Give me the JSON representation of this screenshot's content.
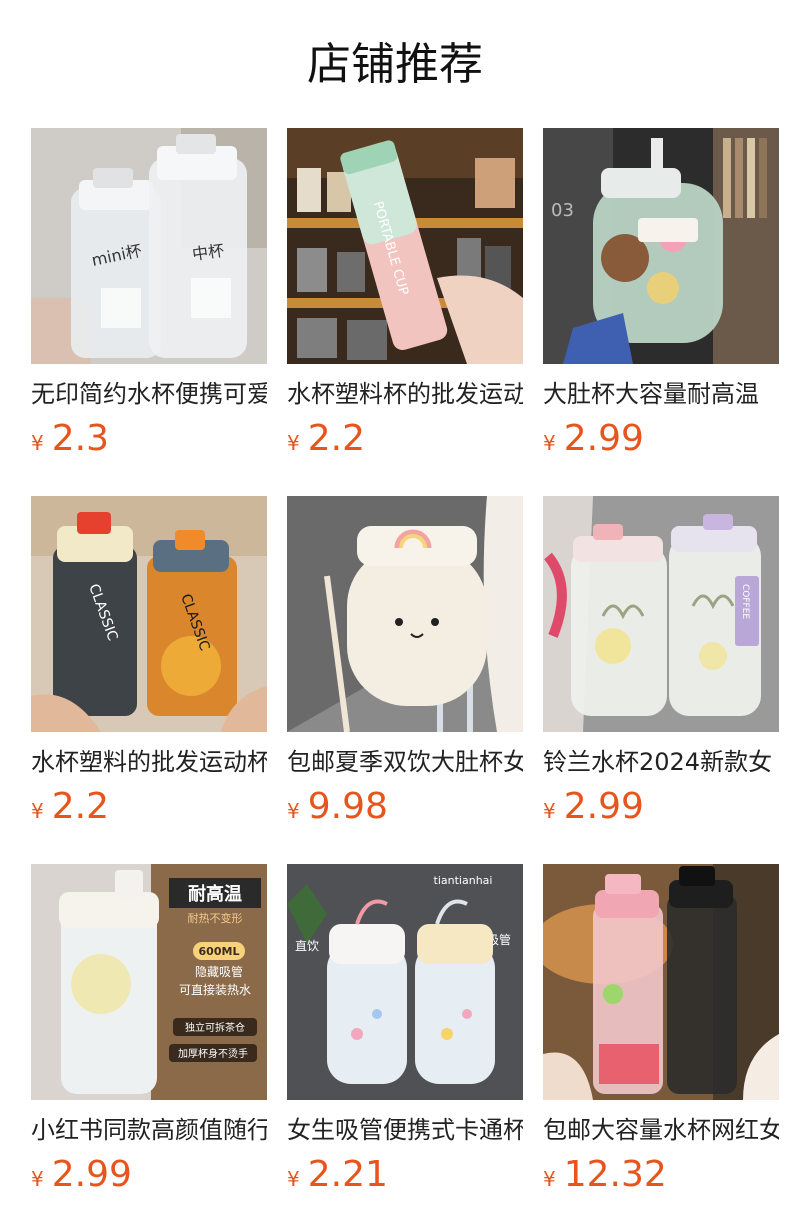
{
  "title": "店铺推荐",
  "colors": {
    "price": "#e8541c",
    "text": "#222222"
  },
  "products": [
    {
      "name": "无印简约水杯便携可爱",
      "currency": "¥",
      "price": "2.3",
      "image_text": [
        "mini杯",
        "中杯"
      ]
    },
    {
      "name": "水杯塑料杯的批发运动",
      "currency": "¥",
      "price": "2.2",
      "image_text": [
        "PORTABLE CUP"
      ]
    },
    {
      "name": "大肚杯大容量耐高温",
      "currency": "¥",
      "price": "2.99",
      "image_text": [
        "03"
      ]
    },
    {
      "name": "水杯塑料的批发运动杯",
      "currency": "¥",
      "price": "2.2",
      "image_text": [
        "CLASSIC",
        "CLASSIC"
      ]
    },
    {
      "name": "包邮夏季双饮大肚杯女",
      "currency": "¥",
      "price": "9.98",
      "image_text": []
    },
    {
      "name": "铃兰水杯2024新款女",
      "currency": "¥",
      "price": "2.99",
      "image_text": [
        "COFFEE"
      ]
    },
    {
      "name": "小红书同款高颜值随行",
      "currency": "¥",
      "price": "2.99",
      "image_text": [
        "耐高温",
        "耐热不变形",
        "600ML",
        "隐藏吸管",
        "可直接装热水",
        "独立可拆茶仓",
        "加厚杯身不烫手"
      ]
    },
    {
      "name": "女生吸管便携式卡通杯",
      "currency": "¥",
      "price": "2.21",
      "image_text": [
        "tiantianhai",
        "直饮",
        "吸管"
      ]
    },
    {
      "name": "包邮大容量水杯网红女",
      "currency": "¥",
      "price": "12.32",
      "image_text": []
    }
  ]
}
